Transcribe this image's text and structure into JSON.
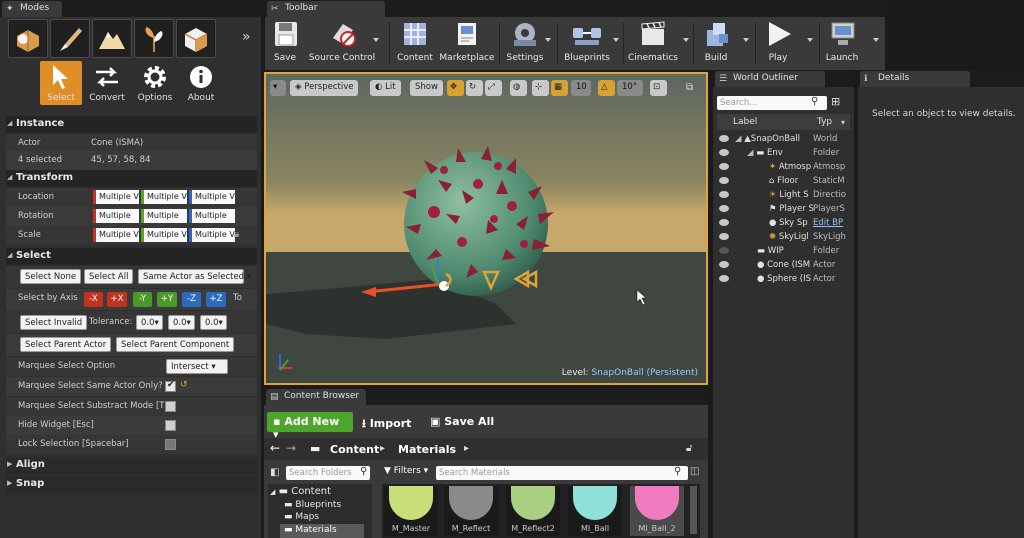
{
  "modes": {
    "tab_title": "Modes",
    "mode_icons": [
      "place-mode-icon",
      "paint-mode-icon",
      "landscape-mode-icon",
      "foliage-mode-icon",
      "geometry-mode-icon"
    ],
    "expand": "»",
    "tools": [
      {
        "label": "Select",
        "icon": "cursor-icon"
      },
      {
        "label": "Convert",
        "icon": "convert-arrows-icon"
      },
      {
        "label": "Options",
        "icon": "gear-icon"
      },
      {
        "label": "About",
        "icon": "info-icon"
      }
    ],
    "instance": {
      "header": "Instance",
      "actor_label": "Actor",
      "actor_value": "Cone (ISMA)",
      "selected_label": "4 selected",
      "selected_value": "45, 57, 58, 84"
    },
    "transform": {
      "header": "Transform",
      "location_label": "Location",
      "rotation_label": "Rotation",
      "scale_label": "Scale",
      "multiple": "Multiple V",
      "multiple_plain": "Multiple"
    },
    "select": {
      "header": "Select",
      "select_none": "Select None",
      "select_all": "Select All",
      "same_actor": "Same Actor as Selected",
      "by_axis": "Select by Axis",
      "axes": [
        "-X",
        "+X",
        "-Y",
        "+Y",
        "-Z",
        "+Z"
      ],
      "to": "To",
      "select_invalid": "Select Invalid",
      "tolerance": "Tolerance:",
      "tol_value": "0.0",
      "select_parent_actor": "Select Parent Actor",
      "select_parent_component": "Select Parent Component",
      "marquee_option": "Marquee Select Option",
      "marquee_value": "Intersect",
      "marquee_same": "Marquee Select Same Actor Only?",
      "marquee_subtract": "Marquee Select Substract Mode [T",
      "hide_widget": "Hide Widget [Esc]",
      "lock_selection": "Lock Selection [Spacebar]"
    },
    "align": "Align",
    "snap": "Snap"
  },
  "toolbar": {
    "tab_title": "Toolbar",
    "items": [
      {
        "label": "Save",
        "icon": "save-icon"
      },
      {
        "label": "Source Control",
        "icon": "source-control-icon"
      },
      {
        "label": "Content",
        "icon": "content-icon"
      },
      {
        "label": "Marketplace",
        "icon": "marketplace-icon"
      },
      {
        "label": "Settings",
        "icon": "settings-icon"
      },
      {
        "label": "Blueprints",
        "icon": "blueprints-icon"
      },
      {
        "label": "Cinematics",
        "icon": "cinematics-icon"
      },
      {
        "label": "Build",
        "icon": "build-icon"
      },
      {
        "label": "Play",
        "icon": "play-icon"
      },
      {
        "label": "Launch",
        "icon": "launch-icon"
      }
    ]
  },
  "viewport": {
    "perspective": "Perspective",
    "lit": "Lit",
    "show": "Show",
    "grid_snap": "10",
    "rot_snap": "10°",
    "level_label": "Level:",
    "level_name": "SnapOnBall (Persistent)"
  },
  "outliner": {
    "tab_title": "World Outliner",
    "search_placeholder": "Search...",
    "col_label": "Label",
    "col_type": "Typ",
    "rows": [
      {
        "name": "SnapOnBall",
        "type": "World"
      },
      {
        "name": "Env",
        "type": "Folder"
      },
      {
        "name": "Atmosp",
        "type": "Atmosp"
      },
      {
        "name": "Floor",
        "type": "StaticM"
      },
      {
        "name": "Light S",
        "type": "Directio"
      },
      {
        "name": "Player S",
        "type": "PlayerS"
      },
      {
        "name": "Sky Sp",
        "type": "Edit BP"
      },
      {
        "name": "SkyLigl",
        "type": "SkyLigh"
      },
      {
        "name": "WIP",
        "type": "Folder"
      },
      {
        "name": "Cone (ISM",
        "type": "Actor"
      },
      {
        "name": "Sphere (IS",
        "type": "Actor"
      }
    ]
  },
  "details": {
    "tab_title": "Details",
    "empty_text": "Select an object to view details."
  },
  "content_browser": {
    "tab_title": "Content Browser",
    "add_new": "Add New",
    "import": "Import",
    "save_all": "Save All",
    "path_root": "Content",
    "path_current": "Materials",
    "search_folders": "Search Folders",
    "filters": "Filters",
    "search_materials": "Search Materials",
    "tree": [
      "Content",
      "Blueprints",
      "Maps",
      "Materials"
    ],
    "assets": [
      {
        "label": "M_Master",
        "color": "#c9e07a"
      },
      {
        "label": "M_Reflect",
        "color": "#8a8a8a"
      },
      {
        "label": "M_Reflect2",
        "color": "#a8d080"
      },
      {
        "label": "MI_Ball",
        "color": "#8ee0d8"
      },
      {
        "label": "MI_Ball_2",
        "color": "#f07bc0"
      }
    ]
  }
}
